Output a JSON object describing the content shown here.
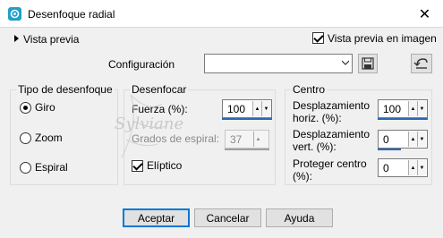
{
  "window": {
    "title": "Desenfoque radial",
    "close_glyph": "✕"
  },
  "preview": {
    "toggle_label": "Vista previa",
    "image_label": "Vista previa en imagen",
    "image_checked": true
  },
  "configuration": {
    "label": "Configuración",
    "value": ""
  },
  "blur_type": {
    "legend": "Tipo de desenfoque",
    "options": [
      {
        "label": "Giro",
        "selected": true
      },
      {
        "label": "Zoom",
        "selected": false
      },
      {
        "label": "Espiral",
        "selected": false
      }
    ]
  },
  "blur": {
    "legend": "Desenfocar",
    "strength_label": "Fuerza (%):",
    "strength_value": "100",
    "spiral_label": "Grados de espiral:",
    "spiral_value": "37",
    "elliptic_label": "Elíptico",
    "elliptic_checked": true
  },
  "center": {
    "legend": "Centro",
    "horiz_label_1": "Desplazamiento",
    "horiz_label_2": "horiz. (%):",
    "horiz_value": "100",
    "vert_label_1": "Desplazamiento",
    "vert_label_2": "vert. (%):",
    "vert_value": "0",
    "protect_label_1": "Proteger centro",
    "protect_label_2": "(%):",
    "protect_value": "0"
  },
  "buttons": {
    "accept": "Aceptar",
    "cancel": "Cancelar",
    "help": "Ayuda"
  },
  "watermark": "Sylviane",
  "colors": {
    "accent": "#0078d7",
    "spin_bar": "#2a6ab5"
  }
}
